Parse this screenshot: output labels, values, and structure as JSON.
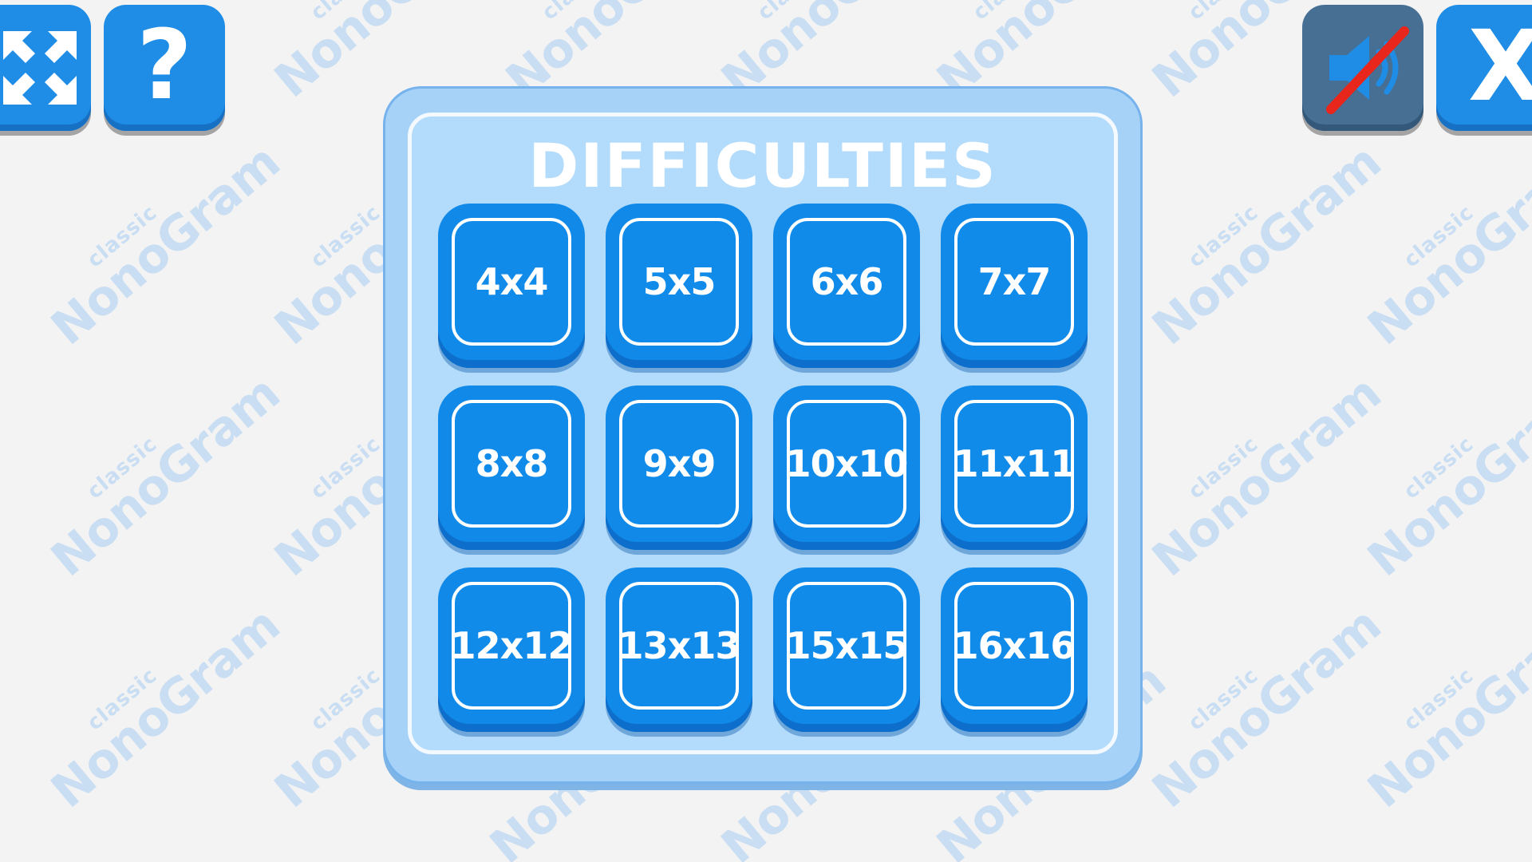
{
  "watermark": {
    "line1": "classic",
    "line2": "NonoGram"
  },
  "toolbar": {
    "fullscreen_icon": "fullscreen-arrows-icon",
    "help_icon": "question-mark-icon",
    "help_label": "?",
    "sound_icon": "speaker-muted-icon",
    "close_icon": "close-x-icon",
    "close_label": "X"
  },
  "panel": {
    "title": "DIFFICULTIES",
    "levels": [
      "4x4",
      "5x5",
      "6x6",
      "7x7",
      "8x8",
      "9x9",
      "10x10",
      "11x11",
      "12x12",
      "13x13",
      "15x15",
      "16x16"
    ]
  },
  "colors": {
    "button_blue": "#1189e8",
    "panel_blue": "#a7d2f8",
    "muted_button": "#466f93",
    "mute_slash": "#e8261b",
    "background": "#f3f3f3"
  }
}
